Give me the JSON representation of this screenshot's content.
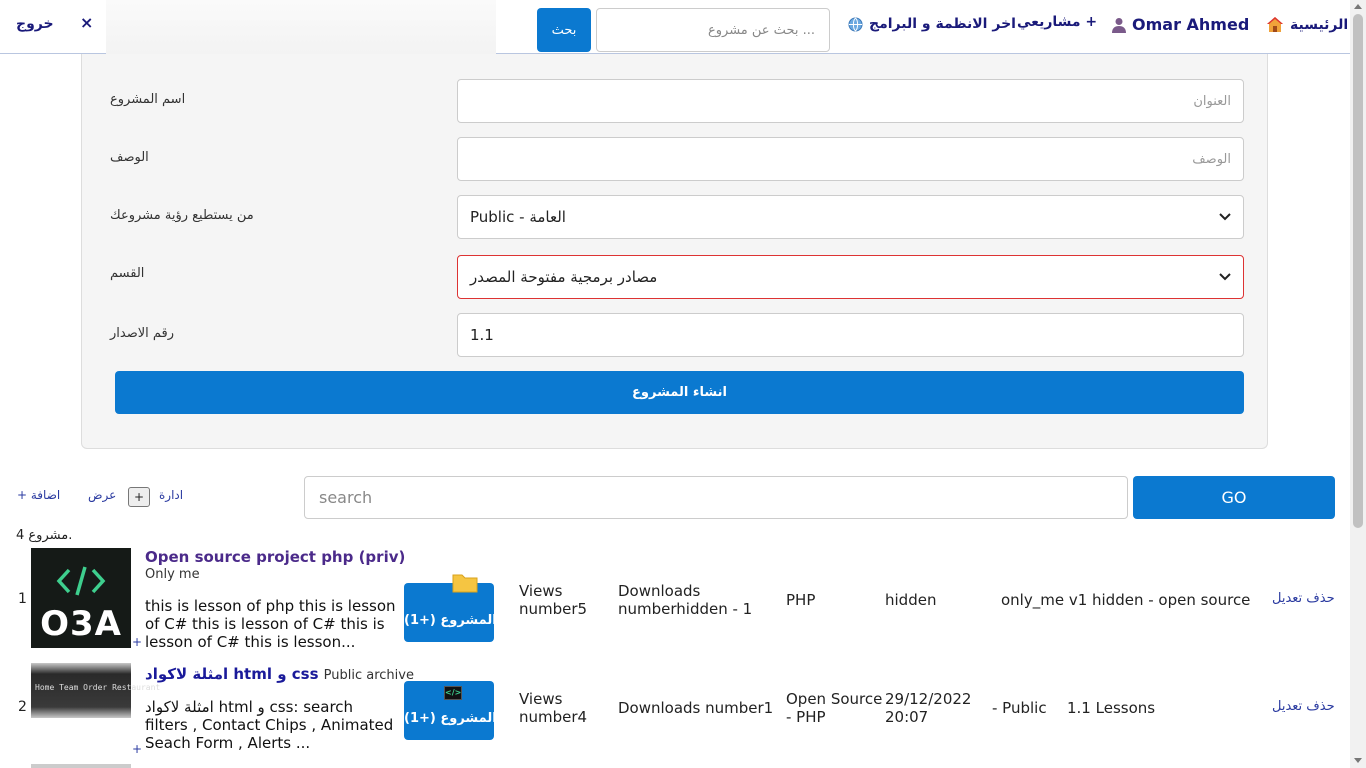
{
  "nav": {
    "home": "الرئيسية",
    "user": "Omar Ahmed",
    "projects": "مشاريعي +",
    "latest": "اخر الانظمة و البرامج",
    "search_placeholder": "... بحث عن مشروع",
    "search_button": "بحث",
    "close": "×",
    "logout": "خروج",
    "icons": {
      "home": "house-icon",
      "user": "user-icon",
      "globe": "globe-icon"
    }
  },
  "form": {
    "name_label": "اسم المشروع",
    "name_placeholder": "العنوان",
    "desc_label": "الوصف",
    "desc_placeholder": "الوصف",
    "visibility_label": "من يستطيع رؤية مشروعك",
    "visibility_value": "Public - العامة",
    "category_label": "القسم",
    "category_value": "مصادر برمجية مفتوحة المصدر",
    "version_label": "رقم الاصدار",
    "version_value": "1.1",
    "submit": "انشاء المشروع"
  },
  "list_toolbar": {
    "add": "+ اضافة",
    "view": "عرض",
    "plus": "+",
    "manage": "ادارة",
    "search_placeholder": "search",
    "go": "GO",
    "count": "4 مشروع."
  },
  "projects": [
    {
      "num": "1",
      "thumb_text": "O3A",
      "title": "Open source project php (priv)",
      "subtitle": "Only me",
      "desc": "this is lesson of php this is lesson of C# this is lesson of C# this is lesson of C# this is lesson...",
      "plus": "+",
      "button": "المشروع (+1)",
      "views": "Views number5",
      "downloads": "Downloads numberhidden - 1",
      "lang": "PHP",
      "date": "hidden",
      "visibility": "only_me v1",
      "lessons": "hidden - open source",
      "actions": "حذف تعديل"
    },
    {
      "num": "2",
      "thumb_text": "Home  Team  Order  Restaurant",
      "title": "امثلة لاكواد html و css",
      "subtitle": "Public archive",
      "desc": "امثلة لاكواد html و css: search filters , Contact Chips , Animated Seach Form , Alerts ...",
      "plus": "+",
      "button": "المشروع (+1)",
      "views": "Views number4",
      "downloads": "Downloads number1",
      "lang": "Open Source - PHP",
      "date": "29/12/2022 20:07",
      "visibility": "- Public",
      "lessons": "1.1 Lessons",
      "actions": "حذف تعديل"
    }
  ],
  "colors": {
    "primary": "#0b79d0",
    "nav_text": "#1a1a7a",
    "link": "#2a3aa0",
    "error_border": "#d33333"
  }
}
